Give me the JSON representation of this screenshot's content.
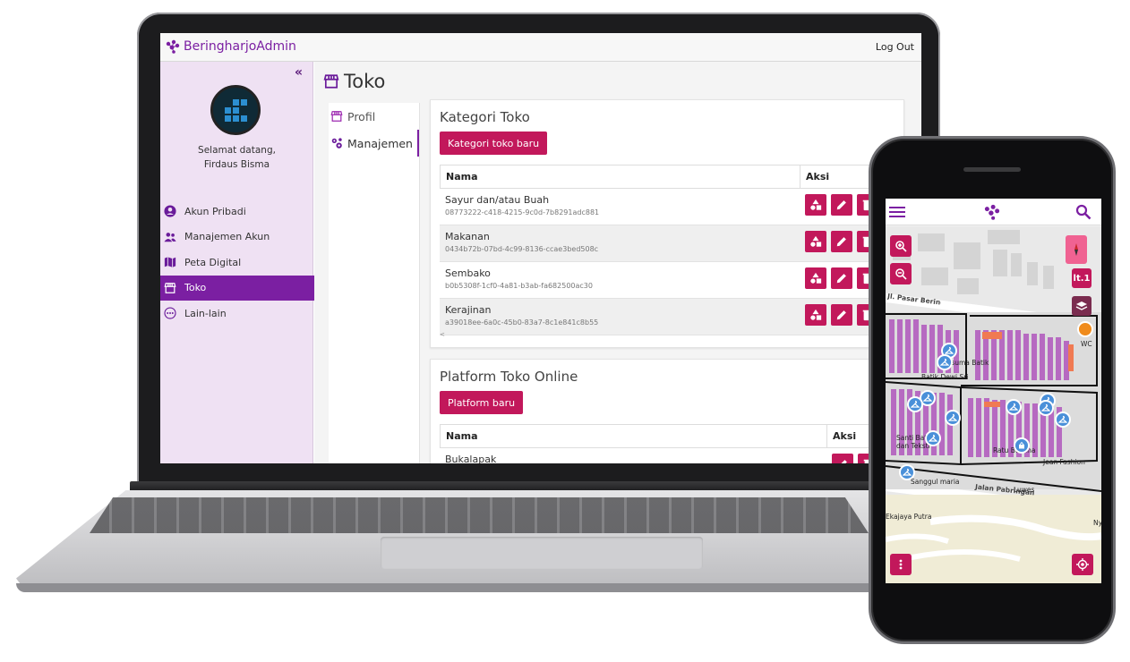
{
  "app": {
    "brand": "BeringharjoAdmin",
    "logout": "Log Out"
  },
  "sidebar": {
    "collapse_icon": "double-chevron-left-icon",
    "welcome_line1": "Selamat datang,",
    "welcome_line2": "Firdaus Bisma",
    "items": [
      {
        "label": "Akun Pribadi",
        "icon": "user-circle-icon",
        "active": false
      },
      {
        "label": "Manajemen Akun",
        "icon": "users-icon",
        "active": false
      },
      {
        "label": "Peta Digital",
        "icon": "map-icon",
        "active": false
      },
      {
        "label": "Toko",
        "icon": "store-icon",
        "active": true
      },
      {
        "label": "Lain-lain",
        "icon": "more-circle-icon",
        "active": false
      }
    ]
  },
  "page": {
    "title": "Toko",
    "subnav": [
      {
        "label": "Profil",
        "icon": "store-icon",
        "active": false
      },
      {
        "label": "Manajemen",
        "icon": "cogs-icon",
        "active": true
      }
    ]
  },
  "kategori": {
    "title": "Kategori Toko",
    "new_button": "Kategori toko baru",
    "col_nama": "Nama",
    "col_aksi": "Aksi",
    "rows": [
      {
        "name": "Sayur dan/atau Buah",
        "id": "08773222-c418-4215-9c0d-7b8291adc881"
      },
      {
        "name": "Makanan",
        "id": "0434b72b-07bd-4c99-8136-ccae3bed508c"
      },
      {
        "name": "Sembako",
        "id": "b0b5308f-1cf0-4a81-b3ab-fa682500ac30"
      },
      {
        "name": "Kerajinan",
        "id": "a39018ee-6a0c-45b0-83a7-8c1e841c8b55"
      }
    ],
    "scroll_hint": "<"
  },
  "platform": {
    "title": "Platform Toko Online",
    "new_button": "Platform baru",
    "col_nama": "Nama",
    "col_aksi": "Aksi",
    "rows": [
      {
        "name": "Bukalapak"
      }
    ]
  },
  "mobile": {
    "header_icons": [
      "menu-icon",
      "logo-icon",
      "search-icon"
    ],
    "floor_button": "lt.1",
    "streets": {
      "top": "Jl. Pasar Beringharjo",
      "bottom": "Jalan Pabringan"
    },
    "poi": {
      "wc": "WC"
    },
    "map_labels": [
      "Batik Dewi Sri",
      "Santi Batik dan Teksti",
      "Sanggul maria",
      "Ekajaya Putra",
      "Kusuma Batik",
      "Ratu Busana",
      "Jean Fashion",
      "Luwes",
      "Ny"
    ],
    "accent": "#c2185b"
  },
  "colors": {
    "brand": "#7b1fa2",
    "accent": "#c2185b",
    "sidebar_bg": "#efe1f3"
  }
}
